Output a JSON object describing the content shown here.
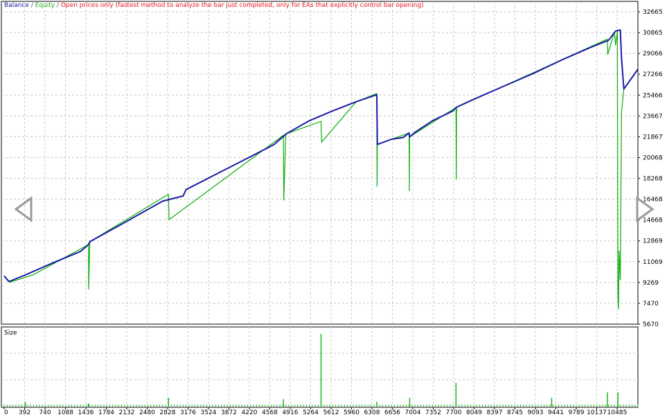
{
  "legend": {
    "balance": "Balance",
    "sep1": " / ",
    "equity": "Equity",
    "sep2": " / ",
    "mode": "Open prices only (fastest method to analyze the bar just completed, only for EAs that explicitly control bar opening)"
  },
  "colors": {
    "balance": "#1a1aa6",
    "equity": "#19b219",
    "mode": "#e8141e",
    "grid": "#c8c8c8",
    "arrow": "#9a9a9a"
  },
  "nav": {
    "prev_icon": "triangle-left-icon",
    "next_icon": "triangle-right-icon"
  },
  "chart_data": [
    {
      "type": "line",
      "title": "",
      "series": [
        {
          "name": "Balance",
          "color": "#1a1aa6",
          "x": [
            0,
            80,
            350,
            800,
            1300,
            1436,
            1460,
            2000,
            2700,
            3050,
            3100,
            3600,
            4200,
            4600,
            4780,
            4800,
            5200,
            5600,
            6000,
            6350,
            6360,
            6600,
            6800,
            6900,
            6910,
            7000,
            7300,
            7650,
            7700,
            8000,
            8500,
            9000,
            9500,
            10000,
            10300,
            10420,
            10500,
            10520,
            10560,
            10800
          ],
          "y": [
            9850,
            9350,
            9900,
            10900,
            11950,
            12550,
            12800,
            14300,
            16300,
            16750,
            17300,
            18600,
            20150,
            21200,
            22000,
            22100,
            23250,
            24100,
            24900,
            25500,
            21200,
            21650,
            21800,
            22200,
            21850,
            22250,
            23250,
            24100,
            24400,
            25100,
            26200,
            27300,
            28500,
            29600,
            30200,
            31000,
            31100,
            28700,
            26000,
            27700
          ]
        },
        {
          "name": "Equity",
          "color": "#19b219",
          "x": [
            0,
            100,
            500,
            1436,
            1440,
            1460,
            2800,
            2810,
            4760,
            4765,
            4800,
            5400,
            5410,
            6000,
            6350,
            6355,
            6360,
            6900,
            6905,
            6910,
            7700,
            7705,
            7710,
            10280,
            10285,
            10400,
            10420,
            10450,
            10460,
            10470,
            10480,
            10500,
            10520,
            10560,
            10800
          ],
          "y": [
            9850,
            9300,
            9950,
            12550,
            8700,
            12800,
            16900,
            14700,
            22000,
            16400,
            22100,
            23200,
            21400,
            24900,
            25600,
            17600,
            21200,
            22200,
            17200,
            21850,
            24400,
            18200,
            24400,
            30300,
            29000,
            30900,
            29800,
            31000,
            8000,
            7000,
            12000,
            9500,
            24000,
            26000,
            27700
          ]
        }
      ],
      "xticks": [
        "0",
        "392",
        "740",
        "1088",
        "1436",
        "1784",
        "2132",
        "2480",
        "2828",
        "3176",
        "3524",
        "3872",
        "4220",
        "4568",
        "4916",
        "5264",
        "5612",
        "5960",
        "6308",
        "6656",
        "7004",
        "7352",
        "7700",
        "8049",
        "8397",
        "8745",
        "9093",
        "9441",
        "9789",
        "10137",
        "10485"
      ],
      "yticks": [
        "5670",
        "7470",
        "9269",
        "11069",
        "12869",
        "14668",
        "16468",
        "18268",
        "20068",
        "21867",
        "23667",
        "25466",
        "27266",
        "29066",
        "30865",
        "32665"
      ],
      "xlim": [
        0,
        10800
      ],
      "ylim": [
        5670,
        33565
      ],
      "grid": true,
      "legend_position": "top-left"
    },
    {
      "type": "bar",
      "title": "Size",
      "series": [
        {
          "name": "",
          "color": "#19b219",
          "x": [
            360,
            1436,
            2800,
            4760,
            5400,
            6350,
            6910,
            7700,
            9330,
            10280,
            10460
          ],
          "values": [
            3,
            2,
            6,
            5,
            53,
            3,
            6,
            17,
            6,
            10,
            10
          ]
        }
      ],
      "baseline_spacing": 50,
      "baseline_value": 1,
      "ylim": [
        0,
        55
      ],
      "grid": true
    }
  ]
}
